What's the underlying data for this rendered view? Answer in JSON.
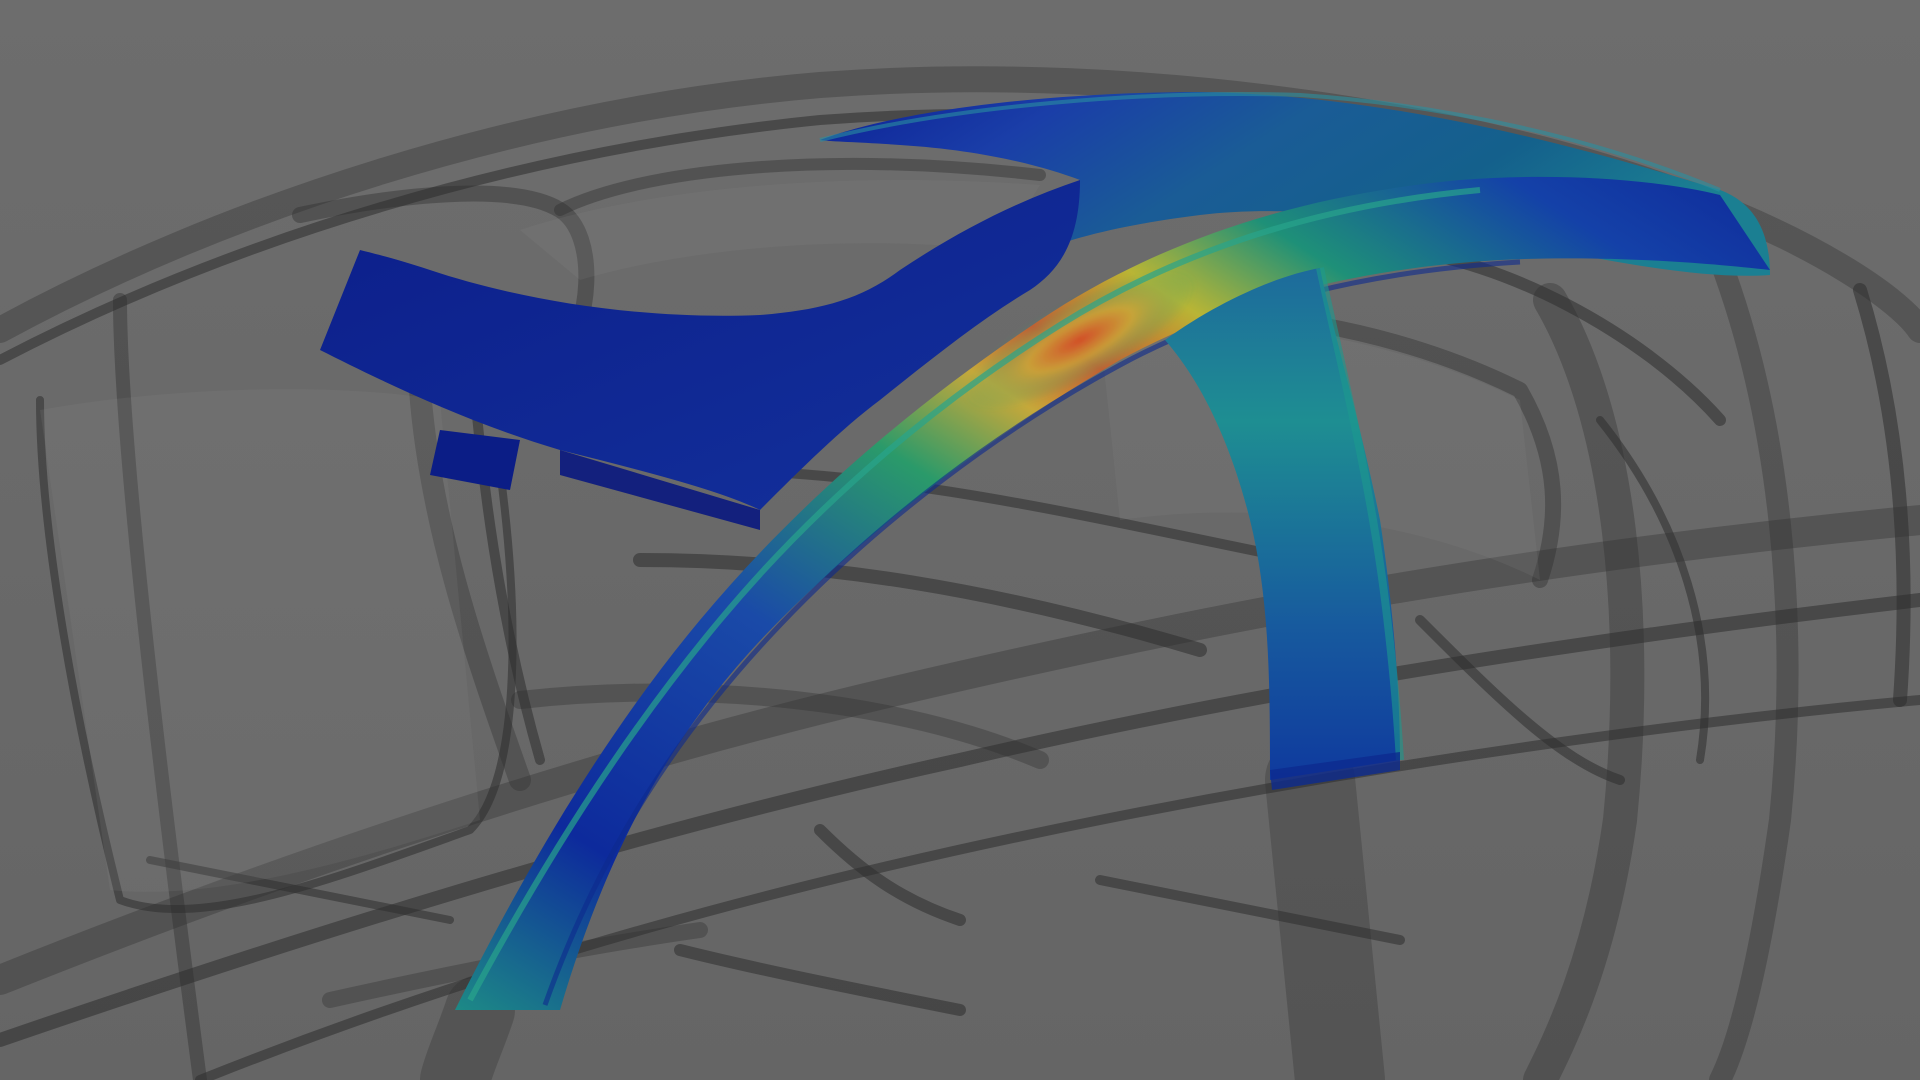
{
  "scene": {
    "background_color": "#6b6b6b",
    "frame_color": "#2a2a2a",
    "colormap": [
      "#0b1a8c",
      "#0d3aa8",
      "#1467a4",
      "#1a8a8a",
      "#2fa35a",
      "#c9b82a",
      "#d5562a"
    ]
  }
}
